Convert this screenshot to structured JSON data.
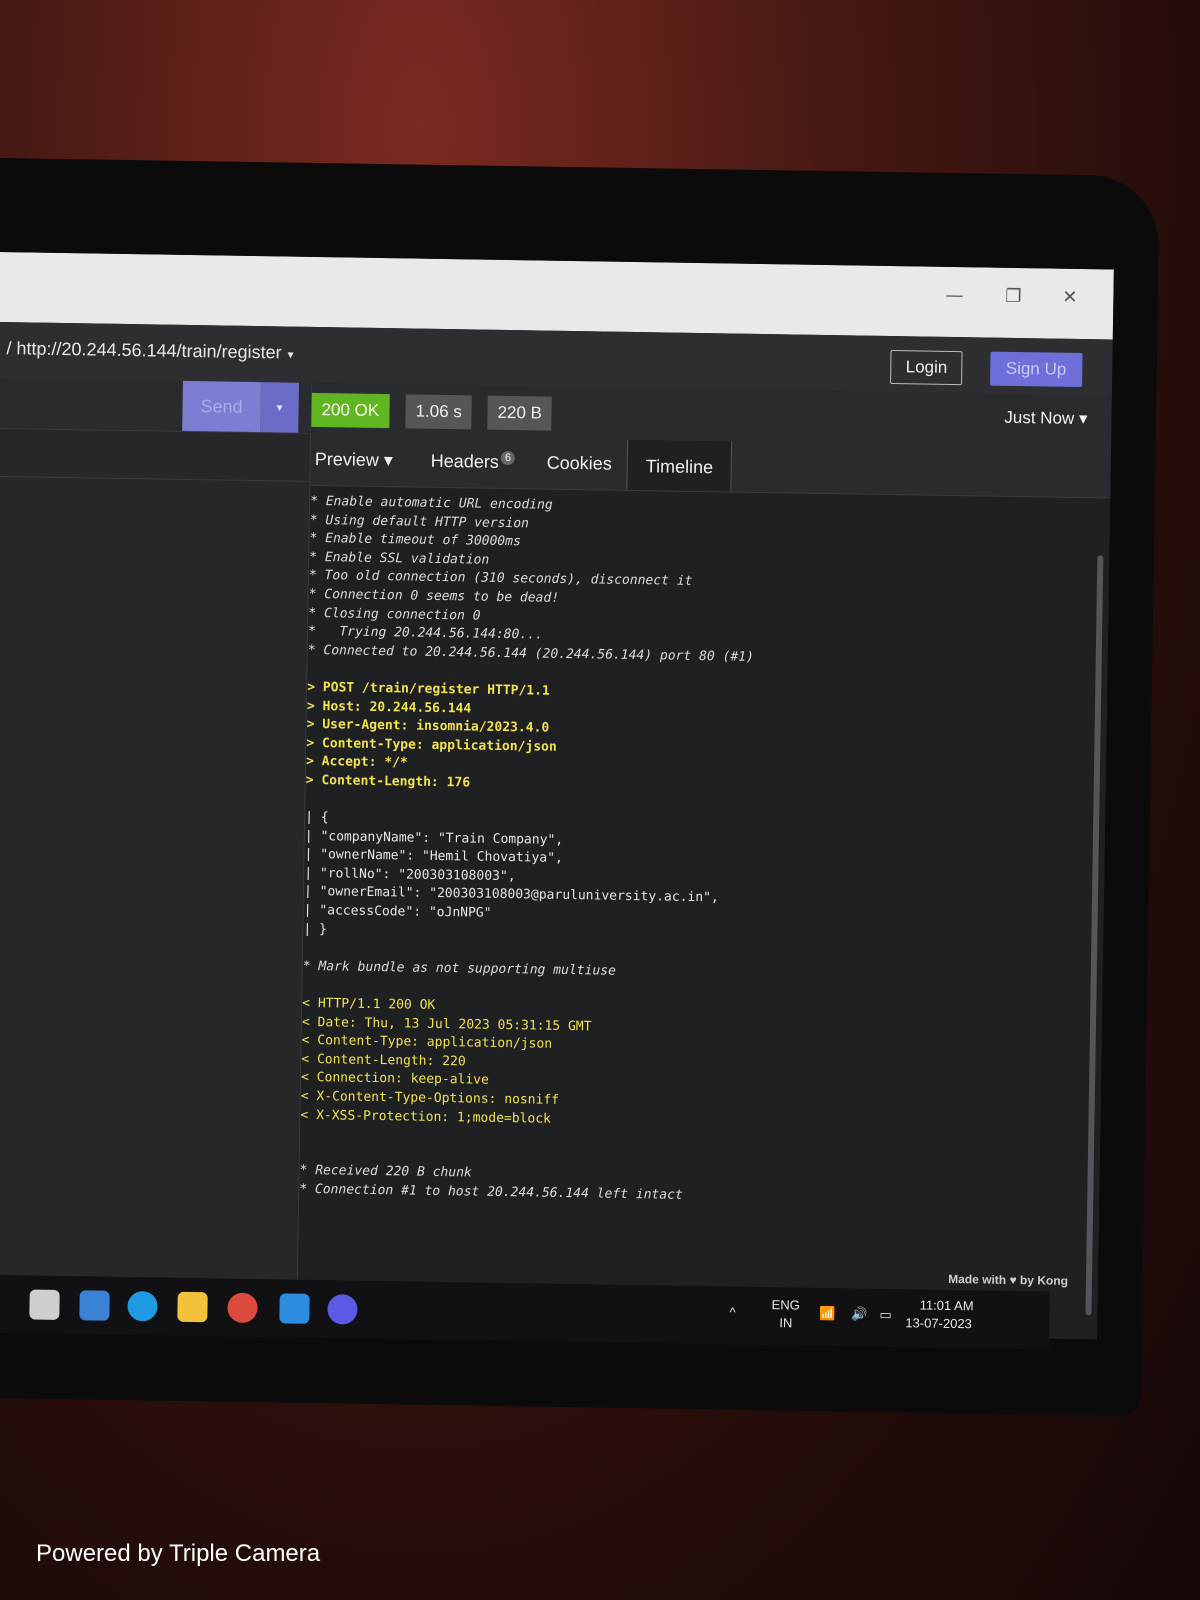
{
  "window": {
    "minimize": "—",
    "restore": "❐",
    "close": "✕"
  },
  "header": {
    "url": "/ http://20.244.56.144/train/register",
    "caret": "▾",
    "login_label": "Login",
    "signup_label": "Sign Up"
  },
  "request": {
    "send_label": "Send",
    "send_caret": "▾"
  },
  "response": {
    "status": "200 OK",
    "time": "1.06 s",
    "size": "220 B",
    "history": "Just Now ▾",
    "tabs": [
      {
        "label": "Preview ▾"
      },
      {
        "label": "Headers",
        "count": "6"
      },
      {
        "label": "Cookies"
      },
      {
        "label": "Timeline"
      }
    ]
  },
  "timeline": {
    "info_lines": [
      "* Enable automatic URL encoding",
      "* Using default HTTP version",
      "* Enable timeout of 30000ms",
      "* Enable SSL validation",
      "* Too old connection (310 seconds), disconnect it",
      "* Connection 0 seems to be dead!",
      "* Closing connection 0",
      "*   Trying 20.244.56.144:80...",
      "* Connected to 20.244.56.144 (20.244.56.144) port 80 (#1)"
    ],
    "request_lines": [
      "> POST /train/register HTTP/1.1",
      "> Host: 20.244.56.144",
      "> User-Agent: insomnia/2023.4.0",
      "> Content-Type: application/json",
      "> Accept: */*",
      "> Content-Length: 176"
    ],
    "body_lines": [
      "| {",
      "| \"companyName\": \"Train Company\",",
      "| \"ownerName\": \"Hemil Chovatiya\",",
      "| \"rollNo\": \"200303108003\",",
      "| \"ownerEmail\": \"200303108003@paruluniversity.ac.in\",",
      "| \"accessCode\": \"oJnNPG\"",
      "| }"
    ],
    "mark_line": "* Mark bundle as not supporting multiuse",
    "response_lines": [
      "< HTTP/1.1 200 OK",
      "< Date: Thu, 13 Jul 2023 05:31:15 GMT",
      "< Content-Type: application/json",
      "< Content-Length: 220",
      "< Connection: keep-alive",
      "< X-Content-Type-Options: nosniff",
      "< X-XSS-Protection: 1;mode=block"
    ],
    "footer_lines": [
      "* Received 220 B chunk",
      "* Connection #1 to host 20.244.56.144 left intact"
    ]
  },
  "footer": {
    "made_with": "Made with ♥ by Kong"
  },
  "taskbar": {
    "icons": [
      "file-explorer-icon",
      "edge-icon",
      "folder-icon",
      "chrome-icon",
      "vscode-icon",
      "insomnia-icon"
    ],
    "lang": "ENG",
    "region": "IN",
    "time": "11:01 AM",
    "date": "13-07-2023"
  },
  "watermark": "Powered by Triple Camera",
  "colors": {
    "status_ok": "#60b520",
    "accent": "#6e6fd9",
    "log_yellow": "#f2e24e"
  }
}
